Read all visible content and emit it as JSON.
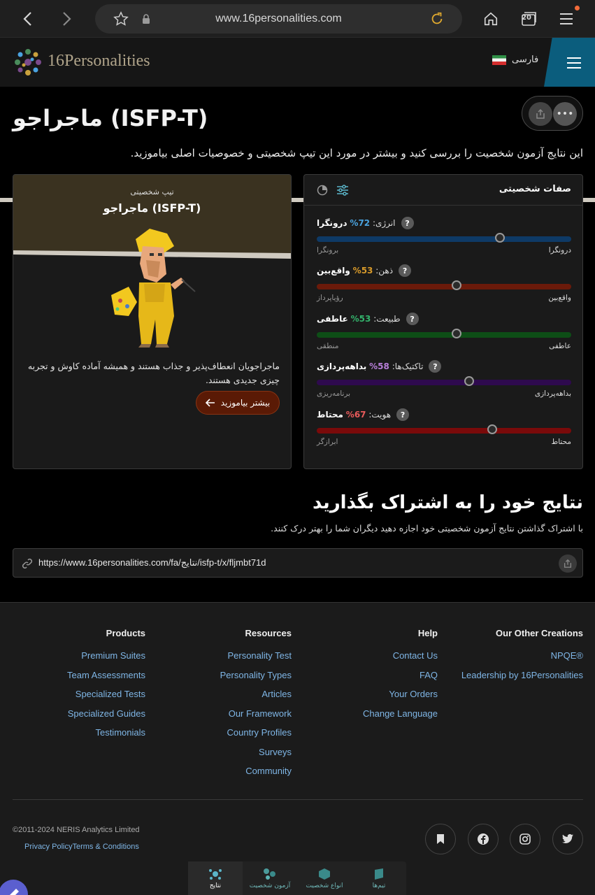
{
  "browser": {
    "url": "www.16personalities.com",
    "tab_count": "20"
  },
  "header": {
    "logo_text": "16Personalities",
    "language": "فارسی"
  },
  "page": {
    "title": "ماجراجو (ISFP-T)",
    "intro": "این نتایج آزمون شخصیت را بررسی کنید و بیشتر در مورد این تیپ شخصیتی و خصوصیات اصلی بیاموزید."
  },
  "type_card": {
    "label": "تیپ شخصیتی",
    "name": "ماجراجو (ISFP-T)",
    "description": "ماجراجویان انعطاف‌پذیر و جذاب هستند و همیشه آماده کاوش و تجربه چیزی جدیدی هستند.",
    "learn_more": "بیشتر بیاموزید"
  },
  "traits": {
    "title": "صفات شخصیتی",
    "items": [
      {
        "category": "انرژی:",
        "percent": "72%",
        "trait": "درونگرا",
        "left": "برونگرا",
        "right": "درونگرا",
        "value": 0.72,
        "color": "#4aa3df",
        "bar": "#0e3a66"
      },
      {
        "category": "ذهن:",
        "percent": "53%",
        "trait": "واقع‌بین",
        "left": "رؤیاپرداز",
        "right": "واقع‌بین",
        "value": 0.55,
        "color": "#d89a2a",
        "bar": "#6b1a0a"
      },
      {
        "category": "طبیعت:",
        "percent": "53%",
        "trait": "عاطفی",
        "left": "منطقی",
        "right": "عاطفی",
        "value": 0.55,
        "color": "#33b26b",
        "bar": "#0d4e16"
      },
      {
        "category": "تاکتیک‌ها:",
        "percent": "58%",
        "trait": "بداهه‌پردازی",
        "left": "برنامه‌ریزی",
        "right": "بداهه‌پردازی",
        "value": 0.6,
        "color": "#b77fd8",
        "bar": "#2e0a4e"
      },
      {
        "category": "هویت:",
        "percent": "67%",
        "trait": "محتاط",
        "left": "ابرازگر",
        "right": "محتاط",
        "value": 0.69,
        "color": "#e85a5a",
        "bar": "#7a0a0a"
      }
    ]
  },
  "share": {
    "title": "نتایج خود را به اشتراک بگذارید",
    "subtitle": "با اشتراک گذاشتن نتایج آزمون شخصیتی خود اجازه دهید دیگران شما را بهتر درک کنند.",
    "url": "https://www.16personalities.com/fa/نتایج/isfp-t/x/fljmbt71d"
  },
  "footer": {
    "columns": [
      {
        "title": "Products",
        "links": [
          "Premium Suites",
          "Team Assessments",
          "Specialized Tests",
          "Specialized Guides",
          "Testimonials"
        ]
      },
      {
        "title": "Resources",
        "links": [
          "Personality Test",
          "Personality Types",
          "Articles",
          "Our Framework",
          "Country Profiles",
          "Surveys",
          "Community"
        ]
      },
      {
        "title": "Help",
        "links": [
          "Contact Us",
          "FAQ",
          "Your Orders",
          "Change Language"
        ]
      },
      {
        "title": "Our Other Creations",
        "links": [
          "NPQE®",
          "Leadership by 16Personalities"
        ]
      }
    ],
    "copyright": "©2011-2024 NERIS Analytics Limited",
    "privacy": "Privacy Policy",
    "terms": "Terms & Conditions"
  },
  "bottom_nav": [
    "نتایج",
    "آزمون شخصیت",
    "انواع شخصیت",
    "تیم‌ها"
  ]
}
